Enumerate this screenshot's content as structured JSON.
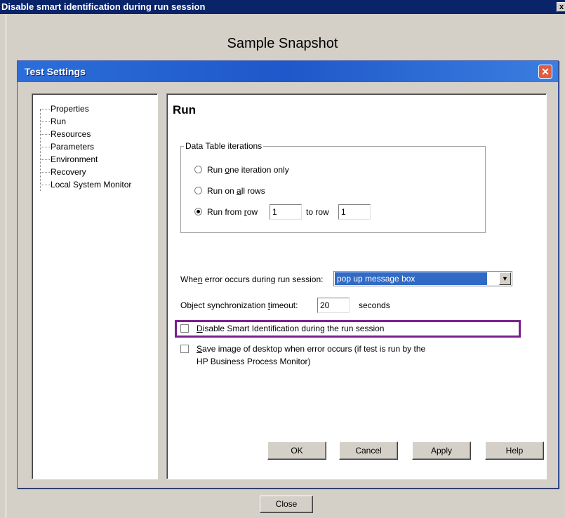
{
  "outer_window": {
    "title": "Disable smart identification during run session",
    "close_glyph": "x"
  },
  "snapshot_title": "Sample Snapshot",
  "dialog": {
    "title": "Test Settings",
    "close_glyph": "✕"
  },
  "tree": {
    "items": [
      "Properties",
      "Run",
      "Resources",
      "Parameters",
      "Environment",
      "Recovery",
      "Local System Monitor"
    ]
  },
  "run_panel": {
    "title": "Run",
    "iterations": {
      "group_label": "Data Table iterations",
      "option_one": {
        "before": "Run ",
        "key": "o",
        "after": "ne iteration only"
      },
      "option_all": {
        "before": "Run on ",
        "key": "a",
        "after": "ll rows"
      },
      "option_range": {
        "before": "Run from ",
        "key": "r",
        "after": "ow"
      },
      "from_row": "1",
      "to_row_label": "to row",
      "to_row": "1",
      "selected": "range"
    },
    "error": {
      "before": "Whe",
      "key": "n",
      "after": " error occurs during run session:",
      "value": "pop up message box"
    },
    "sync": {
      "before": "Object synchronization ",
      "key": "t",
      "after": "imeout:",
      "value": "20",
      "unit": "seconds"
    },
    "disable_smart": {
      "key": "D",
      "after": "isable Smart Identification during the run session",
      "checked": false
    },
    "save_image": {
      "key": "S",
      "line1_after": "ave image of desktop when error occurs (if test is run by the",
      "line2": "HP Business Process Monitor)",
      "checked": false
    }
  },
  "buttons": {
    "ok": "OK",
    "cancel": "Cancel",
    "apply": "Apply",
    "help": "Help"
  },
  "close_button": "Close",
  "colors": {
    "highlight": "#7b1f8e",
    "titlebar": "#2b6ed9",
    "selection": "#316ac5"
  }
}
